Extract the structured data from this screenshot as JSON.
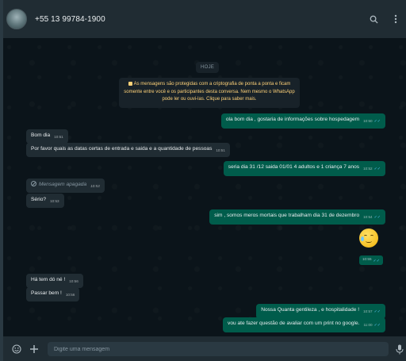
{
  "header": {
    "contact_name": "+55 13 99784-1900",
    "icons": [
      "search-icon",
      "menu-kebab-icon"
    ]
  },
  "conversation": {
    "date_chip": "HOJE",
    "encryption_notice": "As mensagens são protegidas com a criptografia de ponta a ponta e ficam somente entre você e os participantes desta conversa. Nem mesmo o WhatsApp pode ler ou ouvi-las. Clique para saber mais.",
    "messages": [
      {
        "text": "ola bom dia , gostaria de informações sobre hospedagem",
        "time": "10:50",
        "direction": "out"
      },
      {
        "text": "Bom dia",
        "time": "10:51",
        "direction": "in"
      },
      {
        "text": "Por favor quais as datas certas de entrada e saida e a quantidade de pessoas",
        "time": "10:51",
        "direction": "in"
      },
      {
        "text": "seria dia 31 /12 saida 01/01 4 adultos e 1 criança 7 anos",
        "time": "10:52",
        "direction": "out"
      },
      {
        "text": "Mensagem apagada",
        "time": "10:53",
        "direction": "in",
        "deleted": true
      },
      {
        "text": "Sério?",
        "time": "10:53",
        "direction": "in"
      },
      {
        "text": "sim , somos meros mortais que trabalham dia 31 de dezembro",
        "time": "10:54",
        "direction": "out"
      },
      {
        "text": "🥲",
        "time": "10:55",
        "direction": "out",
        "emoji": true
      },
      {
        "text": "Há tem dó né  !",
        "time": "10:56",
        "direction": "in"
      },
      {
        "text": "Passar bem !",
        "time": "10:56",
        "direction": "in"
      },
      {
        "text": "Nossa Quanta gentileza , e hospitalidade !",
        "time": "10:57",
        "direction": "out"
      },
      {
        "text": "vou ate fazer questão de avaliar com um print no google.",
        "time": "11:00",
        "direction": "out"
      }
    ]
  },
  "footer": {
    "placeholder": "Digite uma mensagem",
    "icons": [
      "emoji-icon",
      "attach-plus-icon",
      "microphone-icon"
    ]
  },
  "colors": {
    "header_bg": "#202c33",
    "chat_bg": "#0b141a",
    "incoming_bubble": "#202c33",
    "outgoing_bubble": "#005c4b",
    "read_ticks": "#53bdeb",
    "notice_text": "#ffd279"
  }
}
